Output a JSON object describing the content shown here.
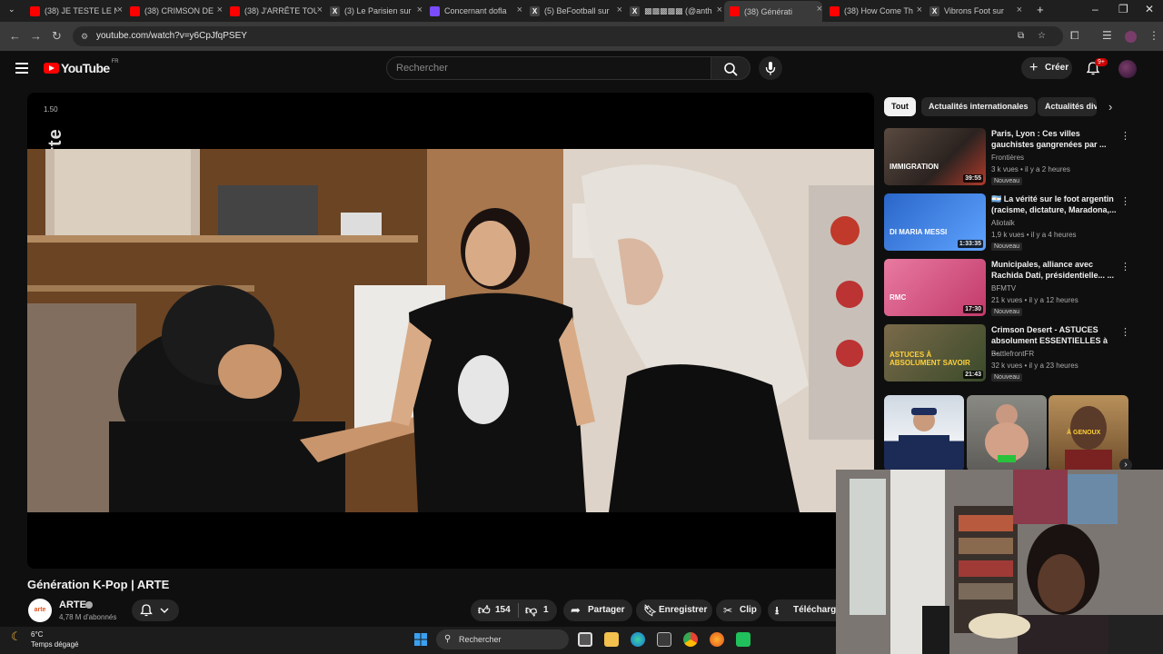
{
  "browser": {
    "tabs": [
      {
        "title": "(38) JE TESTE LE N",
        "color": "#ff0000"
      },
      {
        "title": "(38) CRIMSON DE",
        "color": "#ff0000"
      },
      {
        "title": "(38) J'ARRÊTE TOU",
        "color": "#ff0000"
      },
      {
        "title": "(3) Le Parisien sur",
        "color": "#444444",
        "glyph": "X"
      },
      {
        "title": "Concernant dofla",
        "color": "#7b4cff"
      },
      {
        "title": "(5) BeFootball sur",
        "color": "#444444",
        "glyph": "X"
      },
      {
        "title": "▩▩▩▩▩ (@anth",
        "color": "#444444",
        "glyph": "X"
      },
      {
        "title": "(38) Générati",
        "color": "#ff0000"
      },
      {
        "title": "(38) How Come Th",
        "color": "#ff0000"
      },
      {
        "title": "Vibrons Foot sur",
        "color": "#444444",
        "glyph": "X"
      }
    ],
    "new_tab": "+",
    "url": "youtube.com/watch?v=y6CpJfqPSEY"
  },
  "youtube": {
    "logo_text": "YouTube",
    "logo_region": "FR",
    "search_placeholder": "Rechercher",
    "create_label": "Créer",
    "notif_badge": "9+"
  },
  "player": {
    "speed_overlay": "1.50",
    "channel_watermark": "arte"
  },
  "video": {
    "title": "Génération K-Pop | ARTE",
    "channel": "ARTE",
    "channel_avatar_text": "arte",
    "subscribers": "4,78 M d'abonnés",
    "likes": "154",
    "dislikes": "1",
    "share": "Partager",
    "save": "Enregistrer",
    "clip": "Clip",
    "download": "Télécharger"
  },
  "chips": [
    "Tout",
    "Actualités internationales",
    "Actualités div"
  ],
  "recommendations": [
    {
      "title": "Paris, Lyon : Ces villes gauchistes gangrenées par ...",
      "channel": "Frontières",
      "meta": "3 k vues • il y a 2 heures",
      "duration": "39:55",
      "badge": "Nouveau",
      "thumb_text": "IMMIGRATION",
      "prefix": ""
    },
    {
      "title": "La vérité sur le foot argentin (racisme, dictature, Maradona,...",
      "channel": "Aliotalk",
      "meta": "1,9 k vues • il y a 4 heures",
      "duration": "1:33:35",
      "badge": "Nouveau",
      "thumb_text": "DI MARIA MESSI",
      "prefix": "🇦🇷 "
    },
    {
      "title": "Municipales, alliance avec Rachida Dati, présidentielle... ...",
      "channel": "BFMTV",
      "meta": "21 k vues • il y a 12 heures",
      "duration": "17:30",
      "badge": "Nouveau",
      "thumb_text": "RMC",
      "prefix": ""
    },
    {
      "title": "Crimson Desert - ASTUCES absolument ESSENTIELLES à ...",
      "channel": "BattlefrontFR",
      "meta": "32 k vues • il y a 23 heures",
      "duration": "21:43",
      "badge": "Nouveau",
      "thumb_text": "ASTUCES À ABSOLUMENT SAVOIR",
      "prefix": ""
    }
  ],
  "shorts_caption": "À GENOUX",
  "taskbar": {
    "temperature": "6°C",
    "weather": "Temps dégagé",
    "search": "Rechercher"
  }
}
